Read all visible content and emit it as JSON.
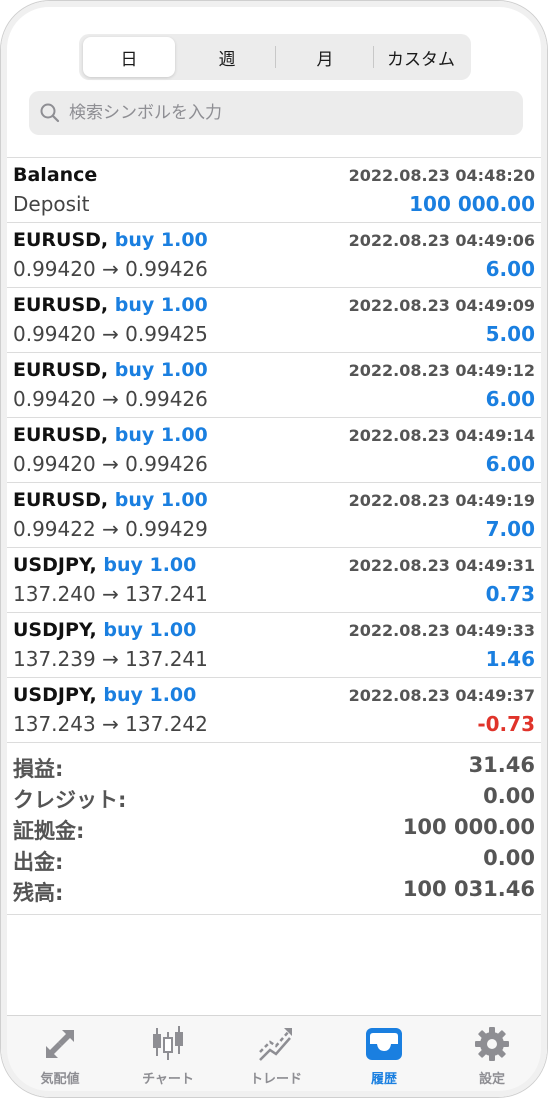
{
  "period_tabs": [
    "日",
    "週",
    "月",
    "カスタム"
  ],
  "selected_period": "日",
  "search": {
    "placeholder": "検索シンボルを入力"
  },
  "rows": [
    {
      "title": "Balance",
      "action": "",
      "time": "2022.08.23 04:48:20",
      "detail": "Deposit",
      "amount": "100 000.00"
    },
    {
      "title": "EURUSD,",
      "action": "buy 1.00",
      "time": "2022.08.23 04:49:06",
      "detail": "0.99420 → 0.99426",
      "amount": "6.00"
    },
    {
      "title": "EURUSD,",
      "action": "buy 1.00",
      "time": "2022.08.23 04:49:09",
      "detail": "0.99420 → 0.99425",
      "amount": "5.00"
    },
    {
      "title": "EURUSD,",
      "action": "buy 1.00",
      "time": "2022.08.23 04:49:12",
      "detail": "0.99420 → 0.99426",
      "amount": "6.00"
    },
    {
      "title": "EURUSD,",
      "action": "buy 1.00",
      "time": "2022.08.23 04:49:14",
      "detail": "0.99420 → 0.99426",
      "amount": "6.00"
    },
    {
      "title": "EURUSD,",
      "action": "buy 1.00",
      "time": "2022.08.23 04:49:19",
      "detail": "0.99422 → 0.99429",
      "amount": "7.00"
    },
    {
      "title": "USDJPY,",
      "action": "buy 1.00",
      "time": "2022.08.23 04:49:31",
      "detail": "137.240 → 137.241",
      "amount": "0.73"
    },
    {
      "title": "USDJPY,",
      "action": "buy 1.00",
      "time": "2022.08.23 04:49:33",
      "detail": "137.239 → 137.241",
      "amount": "1.46"
    },
    {
      "title": "USDJPY,",
      "action": "buy 1.00",
      "time": "2022.08.23 04:49:37",
      "detail": "137.243 → 137.242",
      "amount": "-0.73"
    }
  ],
  "summary": [
    {
      "label": "損益:",
      "value": "31.46"
    },
    {
      "label": "クレジット:",
      "value": "0.00"
    },
    {
      "label": "証拠金:",
      "value": "100 000.00"
    },
    {
      "label": "出金:",
      "value": "0.00"
    },
    {
      "label": "残高:",
      "value": "100 031.46"
    }
  ],
  "tabbar": [
    {
      "label": "気配値",
      "icon": "quotes-arrows-icon"
    },
    {
      "label": "チャート",
      "icon": "candlestick-chart-icon"
    },
    {
      "label": "トレード",
      "icon": "trade-line-icon"
    },
    {
      "label": "履歴",
      "icon": "history-inbox-icon"
    },
    {
      "label": "設定",
      "icon": "gear-icon"
    }
  ],
  "active_tab": "履歴",
  "colors": {
    "accent": "#1a7fe0",
    "negative": "#e0332a",
    "gray_text": "#555555"
  }
}
